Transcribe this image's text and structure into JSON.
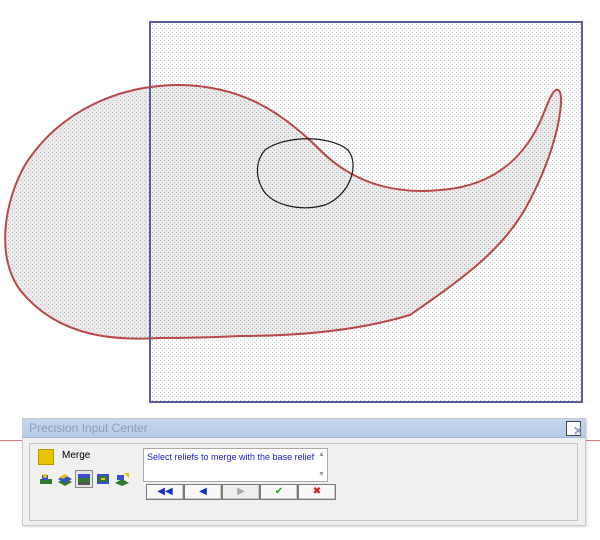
{
  "panel": {
    "title": "Precision Input Center",
    "close_label": "✕",
    "merge_label": "Merge",
    "prompt": "Select reliefs to merge with the base relief",
    "scroll_up": "▲",
    "scroll_down": "▼",
    "nav": {
      "first": "◀◀",
      "prev": "◀",
      "next": "▶",
      "ok": "✔",
      "cancel": "✖"
    }
  },
  "icons": [
    "relief-tool-icon",
    "layer-tool-icon",
    "stacked-relief-icon",
    "relief-grid-icon",
    "merge-relief-icon"
  ],
  "colors": {
    "frame": "#5c5c99",
    "shape_outline": "#b94848",
    "circle_outline": "#1a1a1a",
    "prompt_text": "#1a1ad6",
    "ok": "#19a319",
    "cancel": "#d11a1a",
    "nav_arrow": "#1030d0"
  }
}
